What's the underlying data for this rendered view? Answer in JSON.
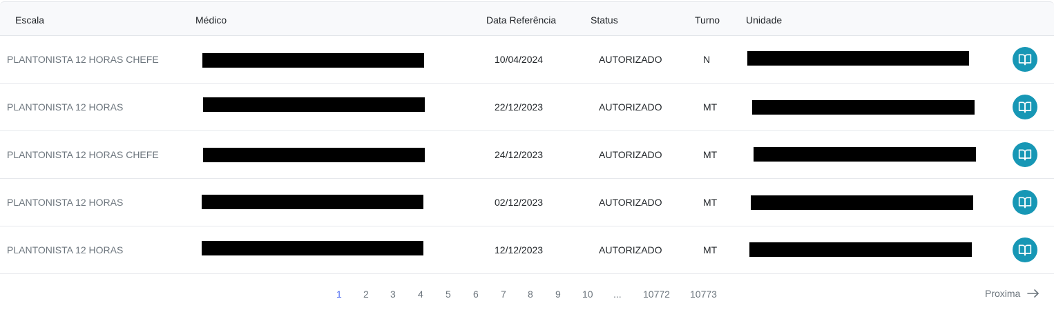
{
  "columns": {
    "escala": "Escala",
    "medico": "Médico",
    "data_referencia": "Data Referência",
    "status": "Status",
    "turno": "Turno",
    "unidade": "Unidade"
  },
  "rows": [
    {
      "escala": "PLANTONISTA 12 HORAS CHEFE",
      "data": "10/04/2024",
      "status": "AUTORIZADO",
      "turno": "N"
    },
    {
      "escala": "PLANTONISTA 12 HORAS",
      "data": "22/12/2023",
      "status": "AUTORIZADO",
      "turno": "MT"
    },
    {
      "escala": "PLANTONISTA 12 HORAS CHEFE",
      "data": "24/12/2023",
      "status": "AUTORIZADO",
      "turno": "MT"
    },
    {
      "escala": "PLANTONISTA 12 HORAS",
      "data": "02/12/2023",
      "status": "AUTORIZADO",
      "turno": "MT"
    },
    {
      "escala": "PLANTONISTA 12 HORAS",
      "data": "12/12/2023",
      "status": "AUTORIZADO",
      "turno": "MT"
    }
  ],
  "row_action_icon": "book-open-icon",
  "pagination": {
    "pages": [
      "1",
      "2",
      "3",
      "4",
      "5",
      "6",
      "7",
      "8",
      "9",
      "10",
      "...",
      "10772",
      "10773"
    ],
    "current": "1",
    "next_label": "Proxima",
    "next_icon": "arrow-right-icon"
  },
  "colors": {
    "accent": "#1797b5",
    "active_page": "#4f6ef2",
    "muted_text": "#6c757d",
    "header_bg": "#f8f9fb"
  }
}
